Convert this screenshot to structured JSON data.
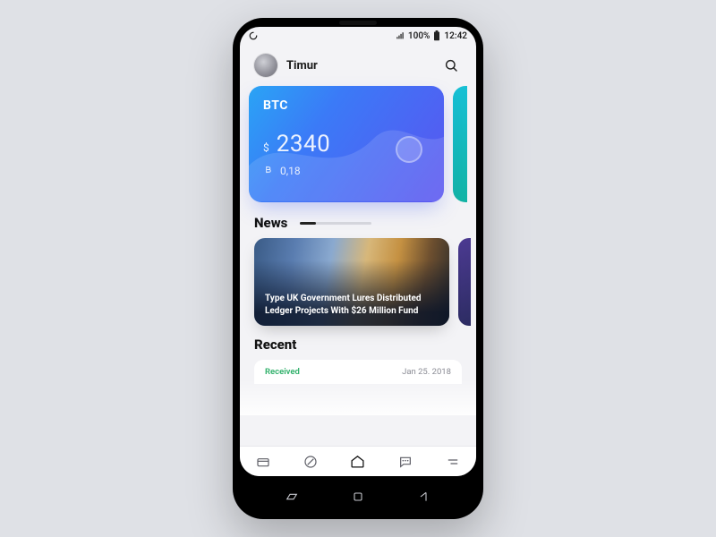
{
  "statusbar": {
    "signal_label": "100%",
    "time": "12:42"
  },
  "header": {
    "username": "Timur"
  },
  "wallet": {
    "ticker": "BTC",
    "fiat_symbol": "$",
    "fiat_amount": "2340",
    "crypto_amount": "0,18"
  },
  "sections": {
    "news_label": "News",
    "recent_label": "Recent"
  },
  "news": {
    "items": [
      {
        "title": "Type UK Government Lures Distributed Ledger Projects With $26 Million Fund"
      }
    ]
  },
  "recent": {
    "items": [
      {
        "label": "Received",
        "date": "Jan 25. 2018"
      }
    ]
  }
}
